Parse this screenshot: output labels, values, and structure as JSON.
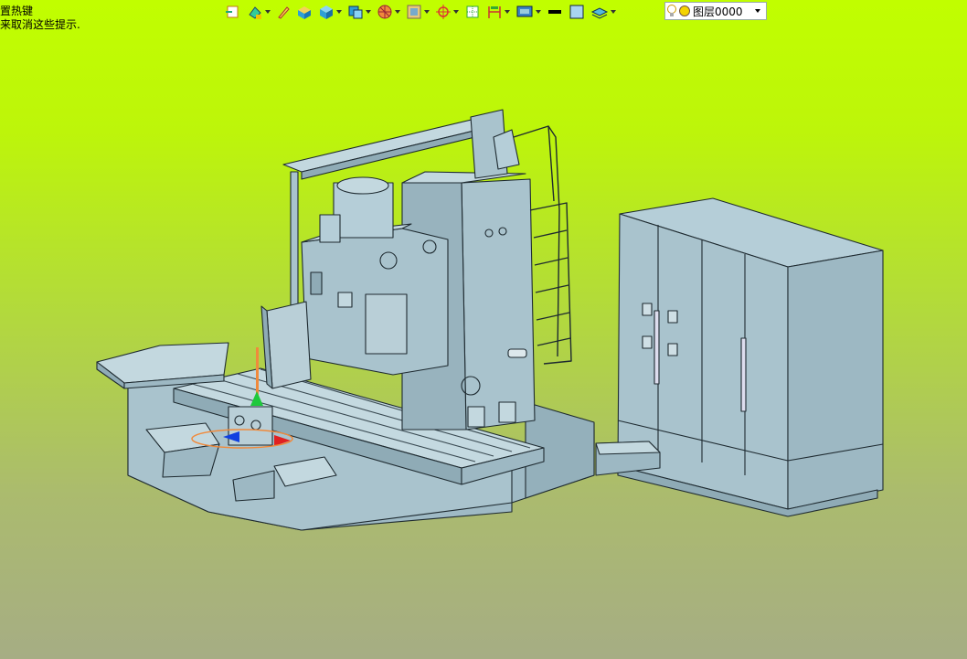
{
  "hint_lines": [
    "置热键",
    "来取消这些提示."
  ],
  "layer": {
    "name": "图层0000"
  },
  "toolbar_icons": [
    "exit-sketch-icon",
    "fill-icon",
    "pencil-icon",
    "solid-box-icon",
    "cube-icon",
    "view-cube-icon",
    "sphere-icon",
    "frame-icon",
    "point-icon",
    "grid-icon",
    "dimension-icon",
    "screen-icon",
    "line-color-icon",
    "fill-color-icon",
    "layers-icon"
  ],
  "colors": {
    "background_top": "#c1fe00",
    "background_bottom": "#a6ad84",
    "model_fill": "#a9c3cd",
    "model_dark": "#8fabb6",
    "model_edge": "#1e2a30"
  }
}
